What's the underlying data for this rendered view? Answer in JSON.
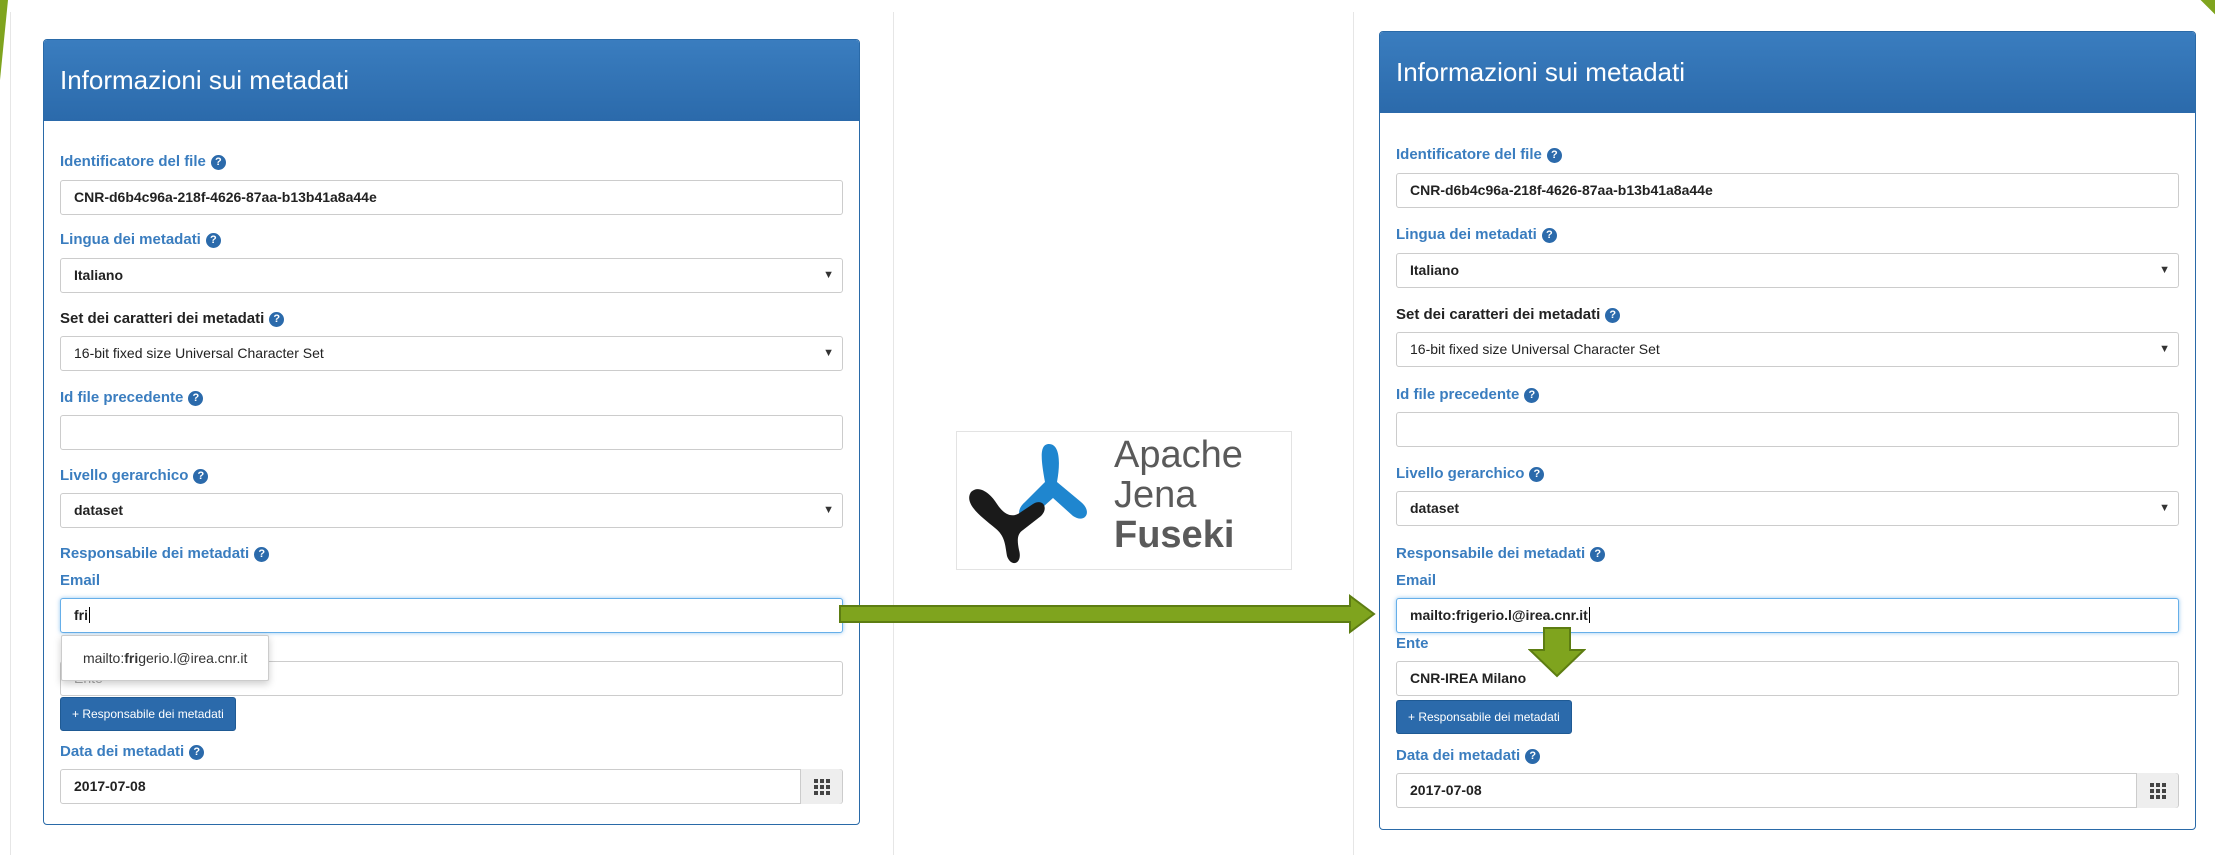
{
  "left_panel": {
    "title": "Informazioni sui metadati",
    "file_id": {
      "label": "Identificatore del file",
      "value": "CNR-d6b4c96a-218f-4626-87aa-b13b41a8a44e"
    },
    "lang": {
      "label": "Lingua dei metadati",
      "value": "Italiano"
    },
    "charset": {
      "label": "Set dei caratteri dei metadati",
      "value": "16-bit fixed size Universal Character Set"
    },
    "prev_id": {
      "label": "Id file precedente",
      "value": ""
    },
    "level": {
      "label": "Livello gerarchico",
      "value": "dataset"
    },
    "resp": {
      "label": "Responsabile dei metadati"
    },
    "email": {
      "label": "Email",
      "value": "fri"
    },
    "ente": {
      "placeholder": "Ente"
    },
    "suggestion": {
      "prefix": "mailto:",
      "match": "fri",
      "rest": "gerio.l@irea.cnr.it"
    },
    "add_button": "+ Responsabile dei metadati",
    "date": {
      "label": "Data dei metadati",
      "value": "2017-07-08"
    }
  },
  "right_panel": {
    "title": "Informazioni sui metadati",
    "file_id": {
      "label": "Identificatore del file",
      "value": "CNR-d6b4c96a-218f-4626-87aa-b13b41a8a44e"
    },
    "lang": {
      "label": "Lingua dei metadati",
      "value": "Italiano"
    },
    "charset": {
      "label": "Set dei caratteri dei metadati",
      "value": "16-bit fixed size Universal Character Set"
    },
    "prev_id": {
      "label": "Id file precedente",
      "value": ""
    },
    "level": {
      "label": "Livello gerarchico",
      "value": "dataset"
    },
    "resp": {
      "label": "Responsabile dei metadati"
    },
    "email": {
      "label": "Email",
      "value": "mailto:frigerio.l@irea.cnr.it"
    },
    "ente": {
      "label": "Ente",
      "value": "CNR-IREA Milano"
    },
    "add_button": "+ Responsabile dei metadati",
    "date": {
      "label": "Data dei metadati",
      "value": "2017-07-08"
    }
  },
  "logo": {
    "line1": "Apache",
    "line2": "Jena",
    "line3": "Fuseki"
  },
  "colors": {
    "accent": "#2b6aab",
    "arrow": "#7fa41e",
    "label": "#3a7dbf"
  },
  "icons": [
    "help-icon",
    "calendar-grid-icon",
    "dropdown-caret-icon",
    "arrow-right-icon",
    "arrow-down-icon",
    "fuseki-logo-icon"
  ]
}
